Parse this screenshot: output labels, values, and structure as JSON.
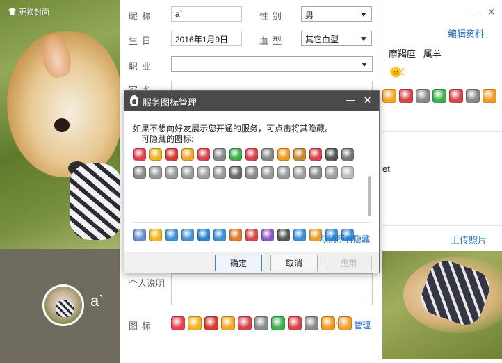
{
  "left": {
    "change_cover": "更换封面",
    "nickname": "aˋ"
  },
  "form": {
    "labels": {
      "nickname": "昵称",
      "gender": "性别",
      "birthday": "生日",
      "blood": "血型",
      "job": "职业",
      "hometown": "家乡",
      "personal_note": "个人说明",
      "icons": "图标"
    },
    "values": {
      "nickname": "aˋ",
      "gender": "男",
      "birthday": "2016年1月9日",
      "blood": "其它血型",
      "job": ""
    },
    "manage": "管理",
    "icon_colors": [
      "#e8414f",
      "#f2b51e",
      "#d93a2e",
      "#f5a623",
      "#d9434a",
      "#8a8a8a",
      "#3cb04a",
      "#d9434a",
      "#888888",
      "#f39a1e",
      "#f6a02a"
    ]
  },
  "right": {
    "edit_profile": "编辑资料",
    "zodiac": "摩羯座",
    "chinese_zodiac": "属羊",
    "upload_photo": "上传照片",
    "partial_text": "et"
  },
  "dialog": {
    "title": "服务图标管理",
    "description": "如果不想向好友展示您开通的服务，可点击将其隐藏。",
    "hidable_label": "可隐藏的图标:",
    "cancel_all_hidden": "取消所有隐藏",
    "ok": "确定",
    "cancel": "取消",
    "apply": "应用",
    "hidable_icon_colors": [
      "#e8414f",
      "#f2b51e",
      "#d93a2e",
      "#f5a623",
      "#d9434a",
      "#8a8a8a",
      "#3cb04a",
      "#d9434a",
      "#888888",
      "#f39a1e",
      "#c98a2e",
      "#d9434a",
      "#555555",
      "#777777",
      "#8a8a8a",
      "#9a9a9a",
      "#9a9a9a",
      "#9a9a9a",
      "#a0a0a0",
      "#9a9a9a",
      "#6a6a6a",
      "#8a8a8a",
      "#9a9a9a",
      "#9a9a9a",
      "#a0a0a0",
      "#8a8a8a",
      "#a0a0a0",
      "#bbbbbb"
    ],
    "hidden_icon_colors": [
      "#6a8fd0",
      "#f2b51e",
      "#3a8fd6",
      "#4a90d9",
      "#2a7fd0",
      "#3a8fd6",
      "#e07a2e",
      "#d9434a",
      "#8a5ac0",
      "#555555",
      "#3a8fd6",
      "#e8a02a",
      "#3a8fd6",
      "#3a8fd6",
      "#8aa0d0",
      "#f2b51e",
      "#e05a4a",
      "#8a5ac0",
      "#3a8fd6",
      "#d9434a",
      "#f2b51e",
      "#8a8a8a",
      "#f2b51e",
      "#3a8fd6",
      "#d9434a",
      "#4a90d9"
    ]
  }
}
